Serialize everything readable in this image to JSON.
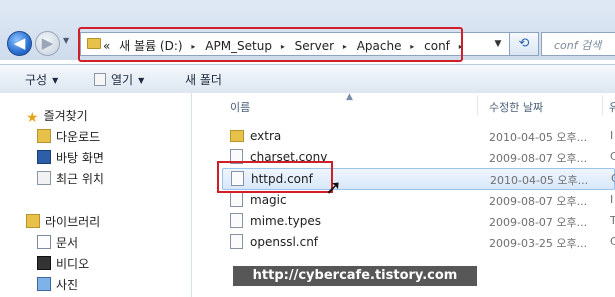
{
  "navigation": {
    "back_label": "◀",
    "forward_label": "▶",
    "recent_label": "▼"
  },
  "address_bar": {
    "overflow": "«",
    "crumbs": [
      "새 볼륨 (D:)",
      "APM_Setup",
      "Server",
      "Apache",
      "conf"
    ],
    "separator": "▸",
    "refresh_label": "⟲",
    "dropdown_label": "▼"
  },
  "search": {
    "placeholder": "conf 검색"
  },
  "toolbar": {
    "organize_label": "구성",
    "open_label": "열기",
    "new_folder_label": "새 폴더",
    "dropdown_label": "▼"
  },
  "sidebar": {
    "favorites_label": "즐겨찾기",
    "favorites": [
      "다운로드",
      "바탕 화면",
      "최근 위치"
    ],
    "libraries_label": "라이브러리",
    "libraries": [
      "문서",
      "비디오",
      "사진"
    ]
  },
  "file_list": {
    "columns": {
      "name": "이름",
      "modified": "수정한 날짜",
      "type": "유"
    },
    "sort_indicator": "▲",
    "rows": [
      {
        "name": "extra",
        "date": "2010-04-05 오후...",
        "type": "I",
        "kind": "folder"
      },
      {
        "name": "charset.conv",
        "date": "2009-08-07 오후...",
        "type": "C",
        "kind": "file"
      },
      {
        "name": "httpd.conf",
        "date": "2010-04-05 오후...",
        "type": "C",
        "kind": "file",
        "selected": true
      },
      {
        "name": "magic",
        "date": "2009-08-07 오후...",
        "type": "I",
        "kind": "file"
      },
      {
        "name": "mime.types",
        "date": "2009-08-07 오후...",
        "type": "T",
        "kind": "file"
      },
      {
        "name": "openssl.cnf",
        "date": "2009-03-25 오후...",
        "type": "C",
        "kind": "file"
      }
    ]
  },
  "watermark": "http://cybercafe.tistory.com",
  "colors": {
    "highlight_border": "#d11f2a",
    "selection_bg": "#d8e8fa"
  }
}
